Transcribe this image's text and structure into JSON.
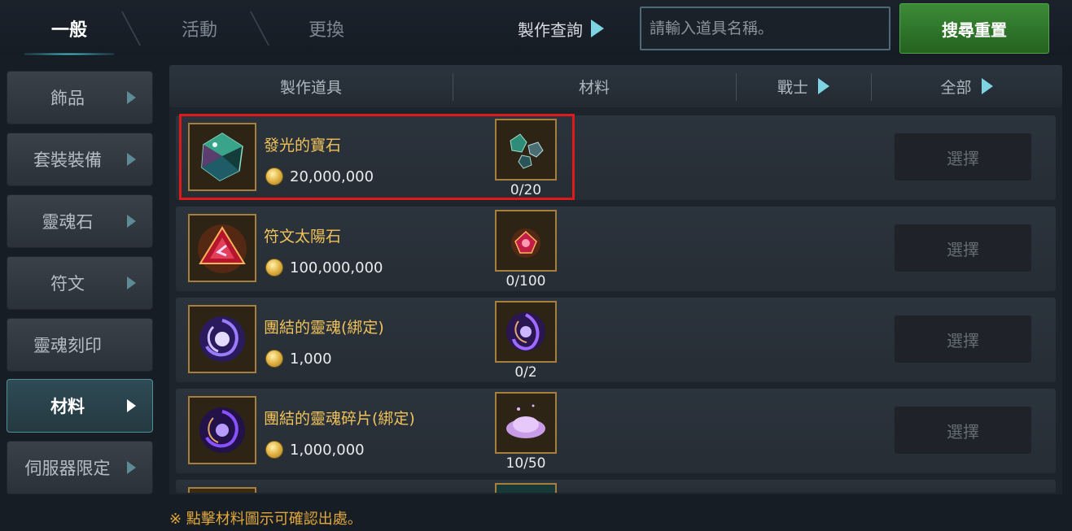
{
  "top_tabs": [
    "一般",
    "活動",
    "更換"
  ],
  "craft_query_label": "製作查詢",
  "search": {
    "placeholder": "請輸入道具名稱。",
    "value": ""
  },
  "reset_button": "搜尋重置",
  "sidebar": {
    "items": [
      {
        "label": "飾品",
        "active": false
      },
      {
        "label": "套裝裝備",
        "active": false
      },
      {
        "label": "靈魂石",
        "active": false
      },
      {
        "label": "符文",
        "active": false
      },
      {
        "label": "靈魂刻印",
        "active": false
      },
      {
        "label": "材料",
        "active": true
      },
      {
        "label": "伺服器限定",
        "active": false
      }
    ]
  },
  "columns": {
    "craft_item": "製作道具",
    "material": "材料",
    "class_filter": "戰士",
    "category_filter": "全部"
  },
  "items": [
    {
      "name": "發光的寶石",
      "price": "20,000,000",
      "material_count": "0/20",
      "select_label": "選擇",
      "icon": "glowing-gem-icon",
      "material_icon": "gem-fragments-icon"
    },
    {
      "name": "符文太陽石",
      "price": "100,000,000",
      "material_count": "0/100",
      "select_label": "選擇",
      "icon": "rune-sunstone-icon",
      "material_icon": "red-crystal-icon"
    },
    {
      "name": "團結的靈魂(綁定)",
      "price": "1,000",
      "material_count": "0/2",
      "select_label": "選擇",
      "icon": "united-soul-icon",
      "material_icon": "soul-flame-icon"
    },
    {
      "name": "團結的靈魂碎片(綁定)",
      "price": "1,000,000",
      "material_count": "10/50",
      "select_label": "選擇",
      "icon": "soul-fragment-icon",
      "material_icon": "soul-dust-icon"
    }
  ],
  "footer_note": "※ 點擊材料圖示可確認出處。",
  "colors": {
    "accent_cyan": "#7fd4e3",
    "item_name_gold": "#f0c25a",
    "reset_green": "#2f7a2a",
    "highlight_red": "#e01a1a"
  }
}
